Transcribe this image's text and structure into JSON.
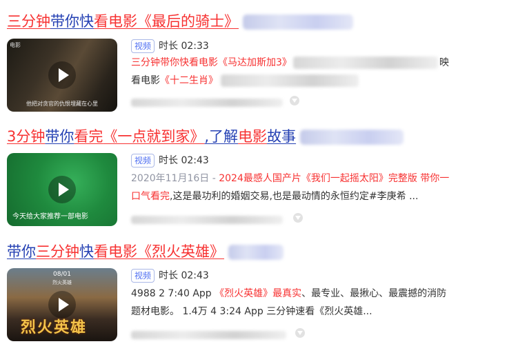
{
  "results": [
    {
      "title_parts": [
        {
          "text": "三分钟",
          "hl": true
        },
        {
          "text": "带你",
          "hl": false
        },
        {
          "text": "快",
          "hl": false
        },
        {
          "text": "看电影",
          "hl": true
        },
        {
          "text": "《最后的骑士》",
          "hl": true
        }
      ],
      "thumbnail": {
        "corner_text": "电影",
        "caption": "他把对贪官的仇恨埋藏在心里"
      },
      "badge": "视频",
      "duration": "时长 02:33",
      "line1": {
        "lead": "三分钟带你快看电影《马达加斯加3》",
        "tail": "映"
      },
      "line2": {
        "lead": "看电影",
        "red": "《十二生肖》"
      }
    },
    {
      "title_parts": [
        {
          "text": "3分钟",
          "hl": true
        },
        {
          "text": "带你",
          "hl": false
        },
        {
          "text": "看完",
          "hl": true
        },
        {
          "text": "《一点就到家》",
          "hl": true
        },
        {
          "text": ",了解",
          "hl": false
        },
        {
          "text": "电影",
          "hl": true
        },
        {
          "text": "故事",
          "hl": false
        }
      ],
      "thumbnail": {
        "caption": "今天给大家推荐一部电影"
      },
      "badge": "视频",
      "duration": "时长 02:43",
      "line1": {
        "date": "2020年11月16日 - ",
        "red": "2024最感人国产片《我们一起摇太阳》完整版 带你一"
      },
      "line2": {
        "red": "口气看完",
        "rest": ",这是最功利的婚姻交易,也是最动情的永恒约定#李庚希 ..."
      }
    },
    {
      "title_parts": [
        {
          "text": "带你",
          "hl": false
        },
        {
          "text": "三分钟",
          "hl": true
        },
        {
          "text": "快",
          "hl": false
        },
        {
          "text": "看电影",
          "hl": true
        },
        {
          "text": "《烈火英雄》",
          "hl": true
        }
      ],
      "thumbnail": {
        "top_text": "08/01",
        "sub_text": "烈火英雄",
        "big_text": "烈火英雄"
      },
      "badge": "视频",
      "duration": "时长 02:43",
      "line1": {
        "lead": "4988 2 7:40 App ",
        "red": "《烈火英雄》最真实",
        "rest": "、最专业、最揪心、最震撼的消防"
      },
      "line2": {
        "text": "题材电影。 1.4万 4 3:24 App 三分钟速看《烈火英雄..."
      }
    }
  ],
  "colors": {
    "link": "#2440b3",
    "highlight": "#f73131",
    "badge": "#4e6ef2",
    "meta_gray": "#9195a3"
  },
  "icons": [
    "play-icon",
    "dropdown-icon"
  ]
}
